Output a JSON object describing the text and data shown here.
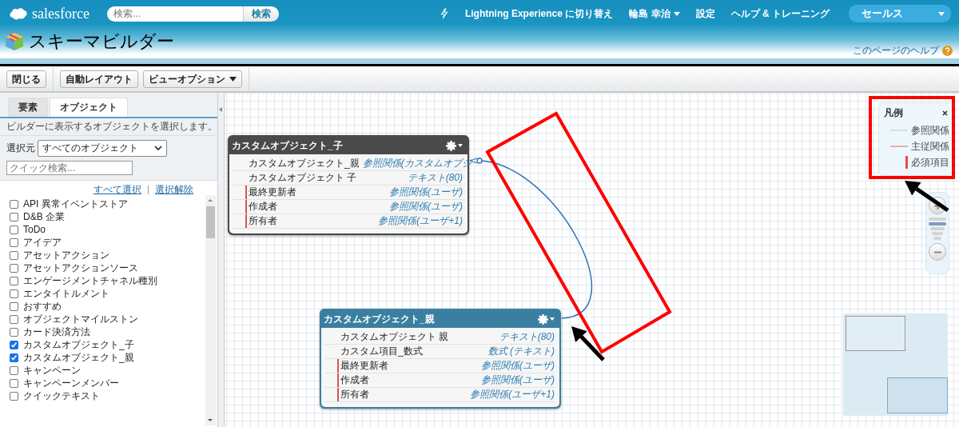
{
  "header": {
    "logo": "salesforce",
    "search": {
      "placeholder": "検索...",
      "button": "検索"
    },
    "links": [
      {
        "kind": "lightning",
        "label": "Lightning Experience に切り替え"
      },
      {
        "kind": "user",
        "label": "輪島 幸治"
      },
      {
        "kind": "plain",
        "label": "設定"
      },
      {
        "kind": "plain",
        "label": "ヘルプ & トレーニング"
      }
    ],
    "app_menu": "セールス"
  },
  "page": {
    "title": "スキーマビルダー",
    "help_link": "このページのヘルプ"
  },
  "toolbar": {
    "buttons": [
      {
        "label": "閉じる",
        "kind": "plain"
      },
      {
        "label": "自動レイアウト",
        "kind": "plain"
      },
      {
        "label": "ビューオプション",
        "kind": "menu"
      }
    ]
  },
  "sidebar": {
    "tabs": [
      {
        "label": "要素",
        "selected": false
      },
      {
        "label": "オブジェクト",
        "selected": true
      }
    ],
    "description": "ビルダーに表示するオブジェクトを選択します。",
    "filter": {
      "label": "選択元",
      "value": "すべてのオブジェクト"
    },
    "quick_search": {
      "placeholder": "クイック検索..."
    },
    "select_all": "すべて選択",
    "deselect_all": "選択解除",
    "items": [
      {
        "label": "API 異常イベントストア",
        "checked": false
      },
      {
        "label": "D&B 企業",
        "checked": false
      },
      {
        "label": "ToDo",
        "checked": false
      },
      {
        "label": "アイデア",
        "checked": false
      },
      {
        "label": "アセットアクション",
        "checked": false
      },
      {
        "label": "アセットアクションソース",
        "checked": false
      },
      {
        "label": "エンゲージメントチャネル種別",
        "checked": false
      },
      {
        "label": "エンタイトルメント",
        "checked": false
      },
      {
        "label": "おすすめ",
        "checked": false
      },
      {
        "label": "オブジェクトマイルストン",
        "checked": false
      },
      {
        "label": "カード決済方法",
        "checked": false
      },
      {
        "label": "カスタムオブジェクト_子",
        "checked": true
      },
      {
        "label": "カスタムオブジェクト_親",
        "checked": true
      },
      {
        "label": "キャンペーン",
        "checked": false
      },
      {
        "label": "キャンペーンメンバー",
        "checked": false
      },
      {
        "label": "クイックテキスト",
        "checked": false
      }
    ]
  },
  "canvas": {
    "nodes": [
      {
        "title": "カスタムオブジェクト_子",
        "selected": false,
        "fields": [
          {
            "name": "カスタムオブジェクト_親",
            "type": "参照関係(カスタムオブジ",
            "required": false
          },
          {
            "name": "カスタムオブジェクト 子",
            "type": "テキスト(80)",
            "required": false
          },
          {
            "name": "最終更新者",
            "type": "参照関係(ユーザ)",
            "required": true
          },
          {
            "name": "作成者",
            "type": "参照関係(ユーザ)",
            "required": true
          },
          {
            "name": "所有者",
            "type": "参照関係(ユーザ+1)",
            "required": true
          }
        ]
      },
      {
        "title": "カスタムオブジェクト_親",
        "selected": true,
        "fields": [
          {
            "name": "カスタムオブジェクト 親",
            "type": "テキスト(80)",
            "required": false
          },
          {
            "name": "カスタム項目_数式",
            "type": "数式 (テキスト)",
            "required": false
          },
          {
            "name": "最終更新者",
            "type": "参照関係(ユーザ)",
            "required": true
          },
          {
            "name": "作成者",
            "type": "参照関係(ユーザ)",
            "required": true
          },
          {
            "name": "所有者",
            "type": "参照関係(ユーザ+1)",
            "required": true
          }
        ]
      }
    ],
    "legend": {
      "title": "凡例",
      "items": [
        {
          "kind": "lookup",
          "label": "参照関係"
        },
        {
          "kind": "master",
          "label": "主従関係"
        },
        {
          "kind": "required",
          "label": "必須項目"
        }
      ]
    },
    "zoom": {
      "level": 0.75
    }
  }
}
